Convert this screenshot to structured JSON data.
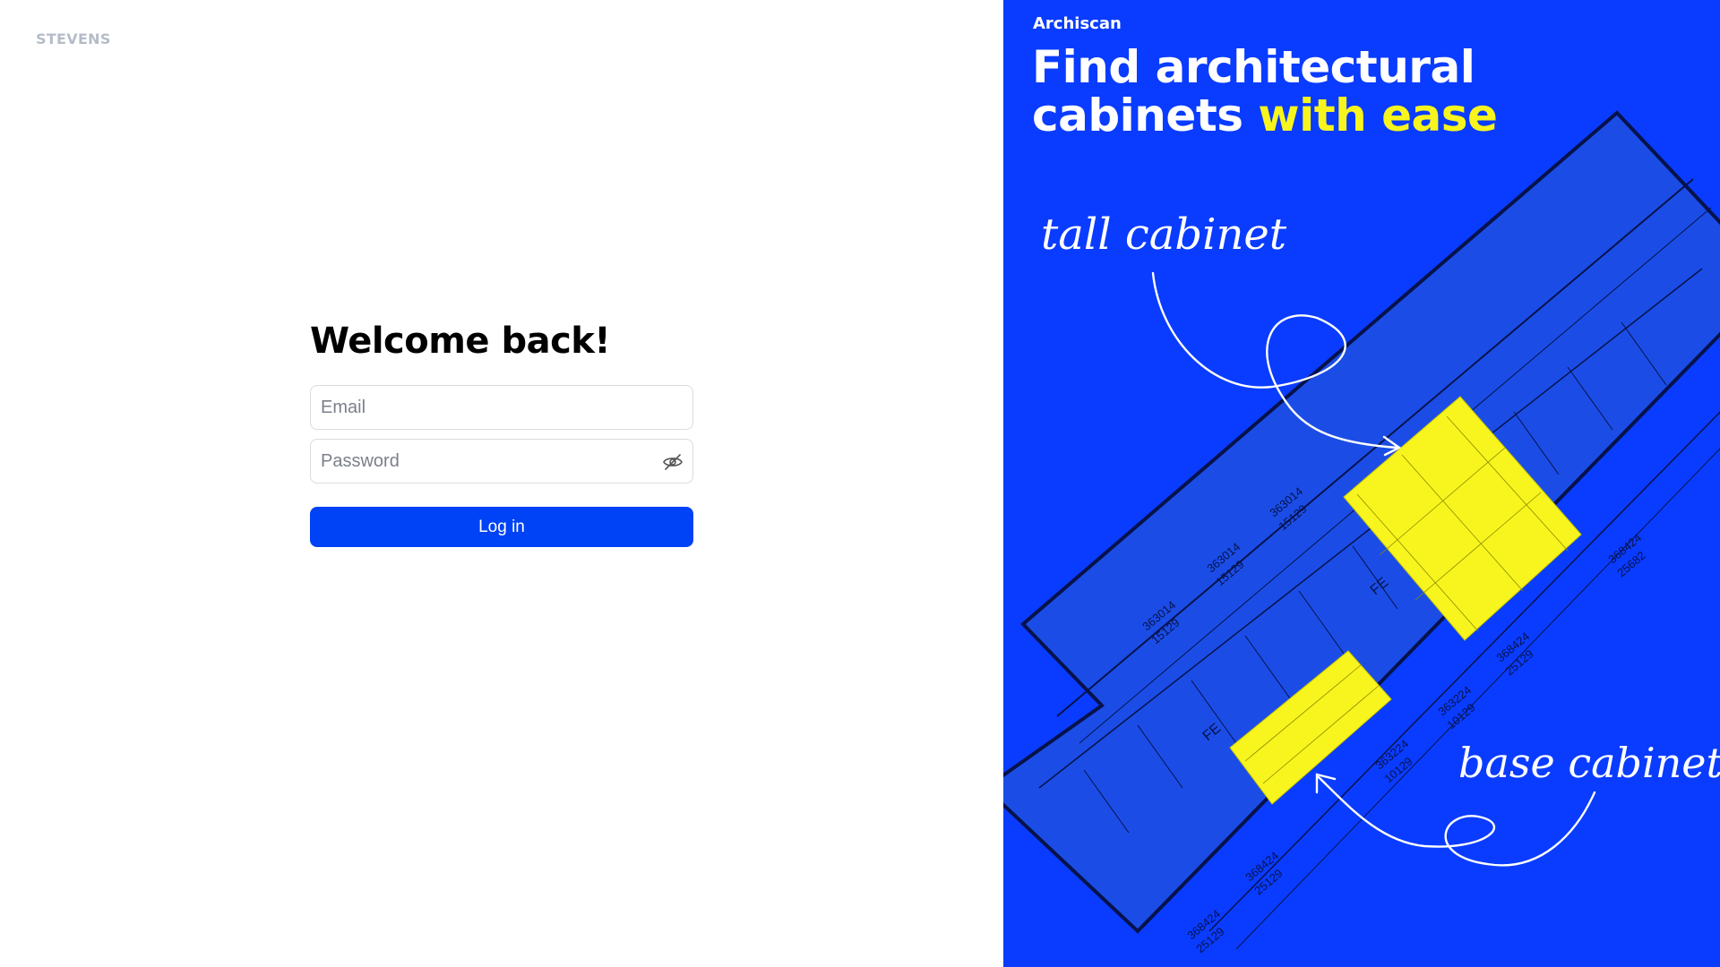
{
  "login": {
    "logo": "STEVENS",
    "heading": "Welcome back!",
    "email_placeholder": "Email",
    "password_placeholder": "Password",
    "login_label": "Log in"
  },
  "promo": {
    "brand": "Archiscan",
    "headline_part1": "Find architectural cabinets ",
    "headline_highlight": "with ease",
    "annotation_tall": "tall cabinet",
    "annotation_base": "base cabinet",
    "dimension_labels": [
      "363014",
      "15129",
      "363014",
      "15129",
      "363014",
      "15129",
      "368424",
      "25129",
      "368424",
      "25129",
      "368424",
      "25129",
      "363224",
      "10129",
      "363224",
      "10129",
      "368424",
      "25682",
      "FE",
      "FE"
    ]
  },
  "colors": {
    "accent": "#0042f5",
    "panel_blue": "#0a3cff",
    "highlight_yellow": "#f7f51d"
  },
  "icons": {
    "password_toggle": "eye-off-icon"
  }
}
